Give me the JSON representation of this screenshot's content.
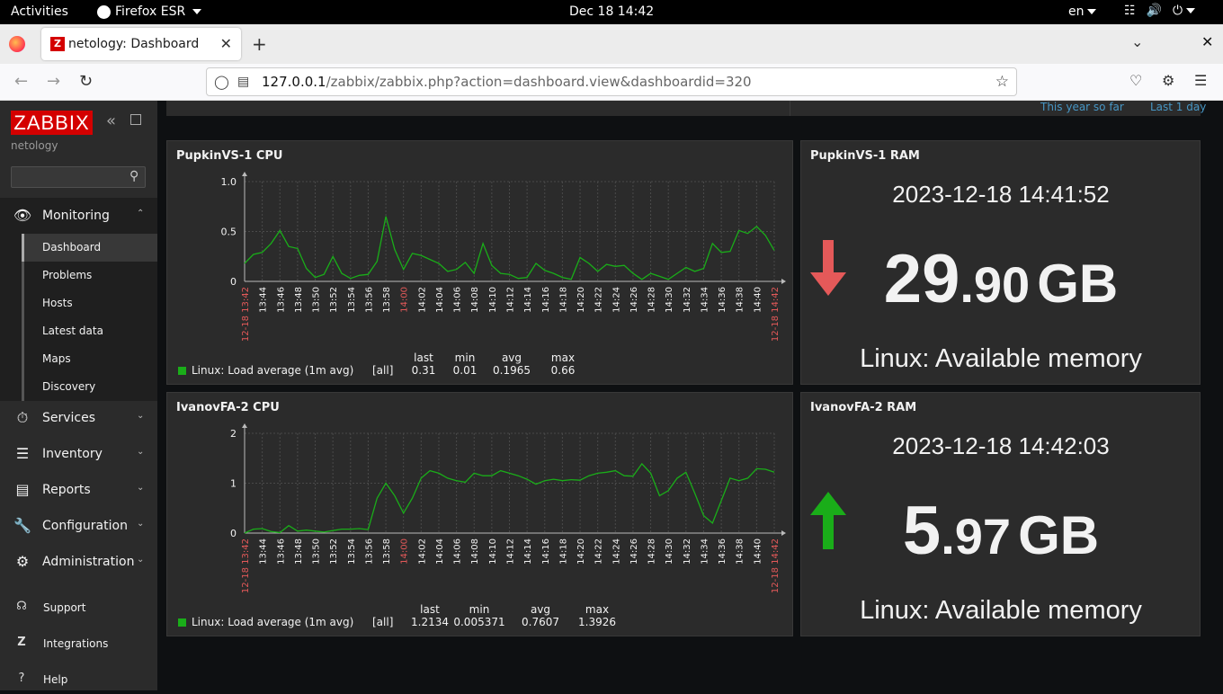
{
  "gnome": {
    "activities": "Activities",
    "app_name": "Firefox ESR",
    "clock": "Dec 18  14:42",
    "lang": "en"
  },
  "browser": {
    "tab_title": "netology: Dashboard",
    "url_host": "127.0.0.1",
    "url_path": "/zabbix/zabbix.php?action=dashboard.view&dashboardid=320"
  },
  "sidebar": {
    "logo": "ZABBIX",
    "instance": "netology",
    "search_placeholder": "",
    "monitoring": "Monitoring",
    "submenu": [
      "Dashboard",
      "Problems",
      "Hosts",
      "Latest data",
      "Maps",
      "Discovery"
    ],
    "services": "Services",
    "inventory": "Inventory",
    "reports": "Reports",
    "configuration": "Configuration",
    "administration": "Administration",
    "support": "Support",
    "integrations": "Integrations",
    "help": "Help"
  },
  "dashboard": {
    "time_links": [
      "This year so far",
      "Last 1 day"
    ]
  },
  "widgets": {
    "cpu1": {
      "title": "PupkinVS-1 CPU",
      "legend_item": "Linux: Load average (1m avg)",
      "legend_all": "[all]",
      "legend_headers": [
        "last",
        "min",
        "avg",
        "max"
      ],
      "legend_values": [
        "0.31",
        "0.01",
        "0.1965",
        "0.66"
      ]
    },
    "ram1": {
      "title": "PupkinVS-1 RAM",
      "timestamp": "2023-12-18 14:41:52",
      "value_int": "29",
      "value_dec": ".90",
      "units": "GB",
      "trend": "down",
      "description": "Linux: Available memory"
    },
    "cpu2": {
      "title": "IvanovFA-2 CPU",
      "legend_item": "Linux: Load average (1m avg)",
      "legend_all": "[all]",
      "legend_headers": [
        "last",
        "min",
        "avg",
        "max"
      ],
      "legend_values": [
        "1.2134",
        "0.005371",
        "0.7607",
        "1.3926"
      ]
    },
    "ram2": {
      "title": "IvanovFA-2 RAM",
      "timestamp": "2023-12-18 14:42:03",
      "value_int": "5",
      "value_dec": ".97",
      "units": "GB",
      "trend": "up",
      "description": "Linux: Available memory"
    }
  },
  "colors": {
    "series": "#1aad19",
    "trend_down": "#e45959",
    "trend_up": "#1aad19",
    "time_marker": "#e45959"
  },
  "chart_data": [
    {
      "type": "line",
      "title": "PupkinVS-1 CPU",
      "x_tick_labels": [
        "12-18 13:42",
        "13:44",
        "13:46",
        "13:48",
        "13:50",
        "13:52",
        "13:54",
        "13:56",
        "13:58",
        "14:00",
        "14:02",
        "14:04",
        "14:06",
        "14:08",
        "14:10",
        "14:12",
        "14:14",
        "14:16",
        "14:18",
        "14:20",
        "14:22",
        "14:24",
        "14:26",
        "14:28",
        "14:30",
        "14:32",
        "14:34",
        "14:36",
        "14:38",
        "14:40",
        "12-18 14:42"
      ],
      "y_tick_labels": [
        "0",
        "0.5",
        "1.0"
      ],
      "ylim": [
        0,
        1.0
      ],
      "grid": true,
      "series": [
        {
          "name": "Linux: Load average (1m avg)",
          "x": [
            0,
            1,
            2,
            3,
            4,
            5,
            6,
            7,
            8,
            9,
            10,
            11,
            12,
            13,
            14,
            15,
            16,
            17,
            18,
            19,
            20,
            21,
            22,
            23,
            24,
            25,
            26,
            27,
            28,
            29,
            30,
            31,
            32,
            33,
            34,
            35,
            36,
            37,
            38,
            39,
            40,
            41,
            42,
            43,
            44,
            45,
            46,
            47,
            48,
            49,
            50,
            51,
            52,
            53,
            54,
            55,
            56,
            57,
            58,
            59,
            60
          ],
          "values": [
            0.18,
            0.27,
            0.29,
            0.38,
            0.51,
            0.35,
            0.33,
            0.13,
            0.04,
            0.07,
            0.25,
            0.08,
            0.03,
            0.06,
            0.07,
            0.2,
            0.65,
            0.32,
            0.12,
            0.28,
            0.26,
            0.22,
            0.18,
            0.1,
            0.12,
            0.19,
            0.08,
            0.38,
            0.16,
            0.08,
            0.07,
            0.03,
            0.04,
            0.18,
            0.11,
            0.08,
            0.04,
            0.02,
            0.24,
            0.18,
            0.1,
            0.17,
            0.15,
            0.16,
            0.08,
            0.02,
            0.08,
            0.05,
            0.02,
            0.08,
            0.14,
            0.1,
            0.13,
            0.38,
            0.29,
            0.3,
            0.51,
            0.48,
            0.55,
            0.46,
            0.31
          ]
        }
      ]
    },
    {
      "type": "line",
      "title": "IvanovFA-2 CPU",
      "x_tick_labels": [
        "12-18 13:42",
        "13:44",
        "13:46",
        "13:48",
        "13:50",
        "13:52",
        "13:54",
        "13:56",
        "13:58",
        "14:00",
        "14:02",
        "14:04",
        "14:06",
        "14:08",
        "14:10",
        "14:12",
        "14:14",
        "14:16",
        "14:18",
        "14:20",
        "14:22",
        "14:24",
        "14:26",
        "14:28",
        "14:30",
        "14:32",
        "14:34",
        "14:36",
        "14:38",
        "14:40",
        "12-18 14:42"
      ],
      "y_tick_labels": [
        "0",
        "1",
        "2"
      ],
      "ylim": [
        0,
        2
      ],
      "grid": true,
      "series": [
        {
          "name": "Linux: Load average (1m avg)",
          "x": [
            0,
            1,
            2,
            3,
            4,
            5,
            6,
            7,
            8,
            9,
            10,
            11,
            12,
            13,
            14,
            15,
            16,
            17,
            18,
            19,
            20,
            21,
            22,
            23,
            24,
            25,
            26,
            27,
            28,
            29,
            30,
            31,
            32,
            33,
            34,
            35,
            36,
            37,
            38,
            39,
            40,
            41,
            42,
            43,
            44,
            45,
            46,
            47,
            48,
            49,
            50,
            51,
            52,
            53,
            54,
            55,
            56,
            57,
            58,
            59,
            60
          ],
          "values": [
            0.0,
            0.08,
            0.09,
            0.03,
            0.01,
            0.15,
            0.04,
            0.06,
            0.04,
            0.02,
            0.05,
            0.08,
            0.08,
            0.09,
            0.07,
            0.7,
            1.0,
            0.75,
            0.4,
            0.7,
            1.1,
            1.25,
            1.2,
            1.1,
            1.05,
            1.02,
            1.2,
            1.15,
            1.15,
            1.25,
            1.2,
            1.15,
            1.08,
            0.98,
            1.05,
            1.08,
            1.05,
            1.07,
            1.06,
            1.15,
            1.2,
            1.22,
            1.25,
            1.15,
            1.14,
            1.39,
            1.2,
            0.75,
            0.85,
            1.1,
            1.22,
            0.8,
            0.35,
            0.2,
            0.65,
            1.1,
            1.05,
            1.1,
            1.29,
            1.28,
            1.22
          ]
        }
      ]
    }
  ]
}
